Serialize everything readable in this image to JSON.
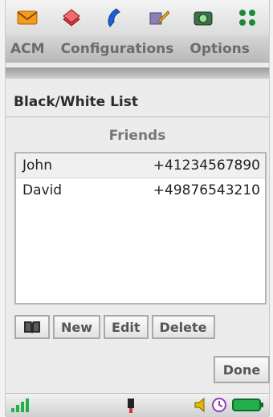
{
  "topbar": {
    "icons": [
      "mail-icon",
      "contacts-book-icon",
      "phone-handset-icon",
      "pen-note-icon",
      "camera-icon",
      "apps-grid-icon"
    ]
  },
  "menu": {
    "items": [
      {
        "label": "ACM"
      },
      {
        "label": "Configurations"
      },
      {
        "label": "Options"
      }
    ]
  },
  "page": {
    "title": "Black/White List",
    "subtitle": "Friends"
  },
  "list": {
    "rows": [
      {
        "name": "John",
        "number": "+41234567890",
        "selected": true
      },
      {
        "name": "David",
        "number": "+49876543210",
        "selected": false
      }
    ]
  },
  "buttons": {
    "phonebook_icon": "phonebook-icon",
    "new_label": "New",
    "edit_label": "Edit",
    "delete_label": "Delete",
    "done_label": "Done"
  },
  "statusbar": {
    "icons": [
      "signal-strength-icon",
      "usb-plug-icon",
      "volume-icon",
      "clock-icon",
      "battery-icon"
    ]
  },
  "colors": {
    "accent_green": "#23b04a",
    "mail_orange": "#f29b1d",
    "book_red": "#d8353a",
    "phone_blue": "#1b5fd6"
  }
}
